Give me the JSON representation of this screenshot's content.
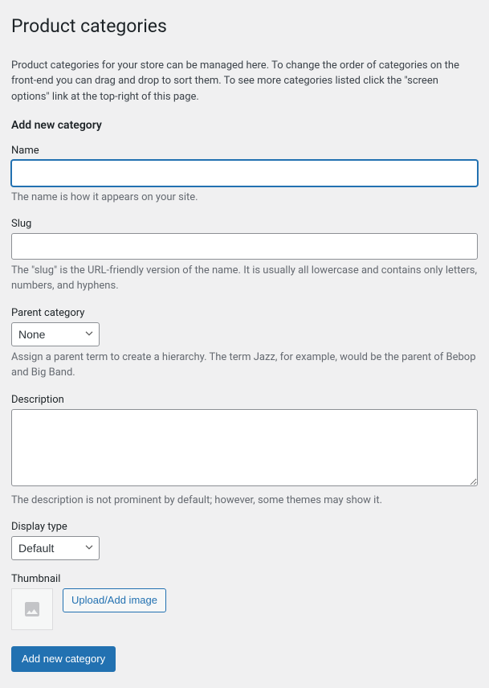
{
  "page": {
    "title": "Product categories",
    "intro": "Product categories for your store can be managed here. To change the order of categories on the front-end you can drag and drop to sort them. To see more categories listed click the \"screen options\" link at the top-right of this page."
  },
  "form": {
    "heading": "Add new category",
    "name": {
      "label": "Name",
      "value": "",
      "help": "The name is how it appears on your site."
    },
    "slug": {
      "label": "Slug",
      "value": "",
      "help": "The \"slug\" is the URL-friendly version of the name. It is usually all lowercase and contains only letters, numbers, and hyphens."
    },
    "parent": {
      "label": "Parent category",
      "selected": "None",
      "help": "Assign a parent term to create a hierarchy. The term Jazz, for example, would be the parent of Bebop and Big Band."
    },
    "description": {
      "label": "Description",
      "value": "",
      "help": "The description is not prominent by default; however, some themes may show it."
    },
    "display_type": {
      "label": "Display type",
      "selected": "Default"
    },
    "thumbnail": {
      "label": "Thumbnail",
      "button": "Upload/Add image"
    },
    "submit": "Add new category"
  }
}
